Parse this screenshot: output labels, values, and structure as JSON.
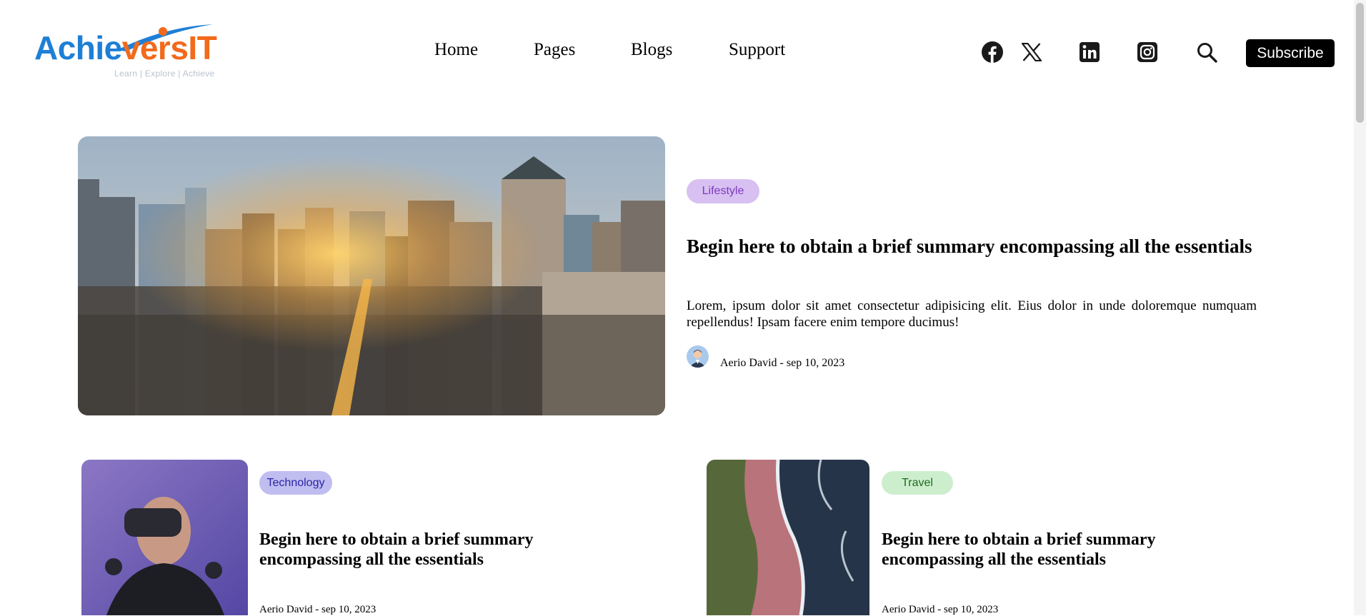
{
  "brand": {
    "name_part1": "Achie",
    "name_part2": "vers",
    "name_part3": "IT",
    "tagline": "Learn | Explore | Achieve",
    "primary_color": "#1e7fd6",
    "accent_color": "#f26a1b"
  },
  "nav": {
    "items": [
      {
        "label": "Home"
      },
      {
        "label": "Pages"
      },
      {
        "label": "Blogs"
      },
      {
        "label": "Support"
      }
    ]
  },
  "header_actions": {
    "social_icons": [
      "facebook-icon",
      "x-icon",
      "linkedin-icon",
      "instagram-icon"
    ],
    "search_icon": "search-icon",
    "subscribe_label": "Subscribe"
  },
  "featured": {
    "category": "Lifestyle",
    "title": "Begin here to obtain a brief summary encompassing all the essentials",
    "excerpt": "Lorem, ipsum dolor sit amet consectetur adipisicing elit. Eius dolor in unde doloremque numquam repellendus! Ipsam facere enim tempore ducimus!",
    "meta": "Aerio David - sep 10, 2023"
  },
  "cards": [
    {
      "category": "Technology",
      "title": "Begin here to obtain a brief summary encompassing all the essentials",
      "meta": "Aerio David - sep 10, 2023"
    },
    {
      "category": "Travel",
      "title": "Begin here to obtain a brief summary encompassing all the essentials",
      "meta": "Aerio David - sep 10, 2023"
    }
  ]
}
